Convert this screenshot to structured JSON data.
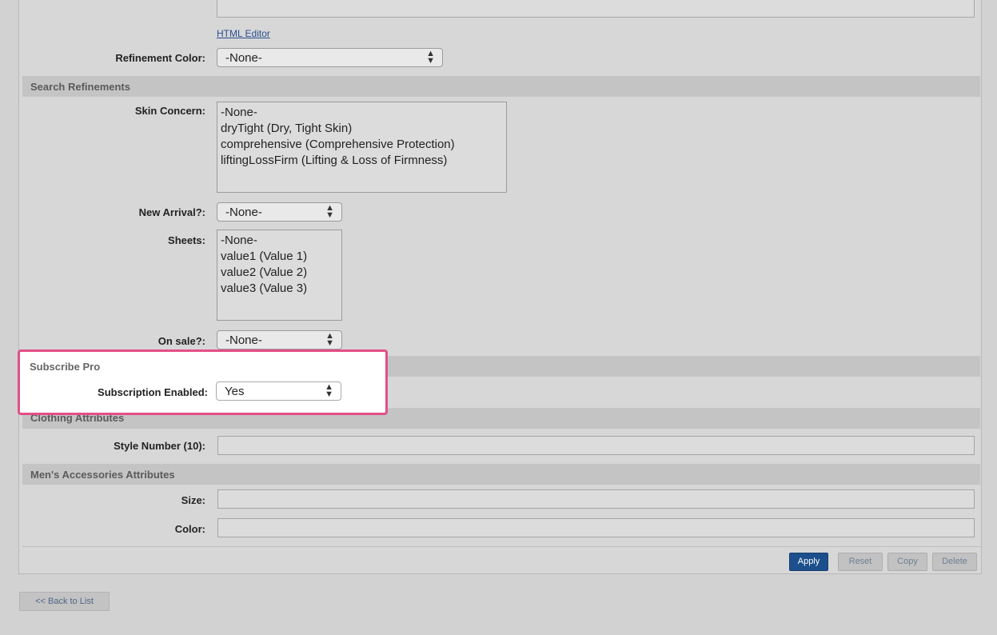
{
  "html_editor_link": "HTML Editor",
  "refinement_color": {
    "label": "Refinement Color:",
    "value": "-None-"
  },
  "sections": {
    "search_refinements": "Search Refinements",
    "subscribe_pro": "Subscribe Pro",
    "clothing_attributes": "Clothing Attributes",
    "mens_accessories": "Men's Accessories Attributes"
  },
  "skin_concern": {
    "label": "Skin Concern:",
    "options": [
      "-None-",
      "dryTight (Dry, Tight Skin)",
      "comprehensive (Comprehensive Protection)",
      "liftingLossFirm (Lifting & Loss of Firmness)"
    ]
  },
  "new_arrival": {
    "label": "New Arrival?:",
    "value": "-None-"
  },
  "sheets": {
    "label": "Sheets:",
    "options": [
      "-None-",
      "value1 (Value 1)",
      "value2 (Value 2)",
      "value3 (Value 3)"
    ]
  },
  "on_sale": {
    "label": "On sale?:",
    "value": "-None-"
  },
  "subscription_enabled": {
    "label": "Subscription Enabled:",
    "value": "Yes"
  },
  "style_number": {
    "label": "Style Number (10):",
    "value": ""
  },
  "size": {
    "label": "Size:",
    "value": ""
  },
  "color": {
    "label": "Color:",
    "value": ""
  },
  "buttons": {
    "apply": "Apply",
    "reset": "Reset",
    "copy": "Copy",
    "delete": "Delete"
  },
  "back_to_list": "<< Back to List",
  "colors": {
    "highlight": "#e34f86",
    "primary_button": "#1c4f8c",
    "link": "#2a4f8f"
  }
}
